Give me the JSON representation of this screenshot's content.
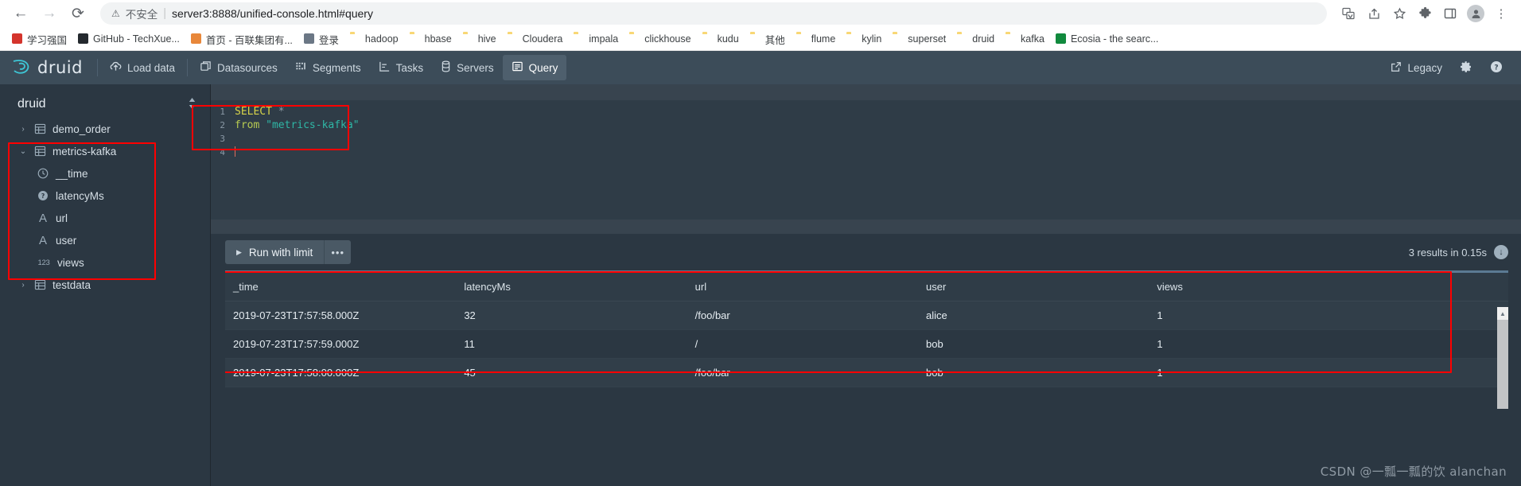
{
  "browser": {
    "back_icon": "back-arrow-icon",
    "forward_icon": "forward-arrow-icon",
    "reload_icon": "reload-icon",
    "security_label": "不安全",
    "url": "server3:8888/unified-console.html#query",
    "toolbar_icons": [
      "translate-icon",
      "share-icon",
      "bookmark-star-icon",
      "extensions-puzzle-icon",
      "sidepanel-icon",
      "profile-avatar-icon",
      "chrome-menu-icon"
    ],
    "bookmarks": [
      {
        "label": "学习强国",
        "icon": "xuexi-icon",
        "color": "#d4342c"
      },
      {
        "label": "GitHub - TechXue...",
        "icon": "github-icon",
        "color": "#24292e"
      },
      {
        "label": "首页 - 百联集团有...",
        "icon": "bailian-icon",
        "color": "#e8873a"
      },
      {
        "label": "登录",
        "icon": "globe-icon",
        "color": "#6b7785"
      },
      {
        "label": "hadoop",
        "icon": "folder-icon",
        "color": "#f8d775"
      },
      {
        "label": "hbase",
        "icon": "folder-icon",
        "color": "#f8d775"
      },
      {
        "label": "hive",
        "icon": "folder-icon",
        "color": "#f8d775"
      },
      {
        "label": "Cloudera",
        "icon": "folder-icon",
        "color": "#f8d775"
      },
      {
        "label": "impala",
        "icon": "folder-icon",
        "color": "#f8d775"
      },
      {
        "label": "clickhouse",
        "icon": "folder-icon",
        "color": "#f8d775"
      },
      {
        "label": "kudu",
        "icon": "folder-icon",
        "color": "#f8d775"
      },
      {
        "label": "其他",
        "icon": "folder-icon",
        "color": "#f8d775"
      },
      {
        "label": "flume",
        "icon": "folder-icon",
        "color": "#f8d775"
      },
      {
        "label": "kylin",
        "icon": "folder-icon",
        "color": "#f8d775"
      },
      {
        "label": "superset",
        "icon": "folder-icon",
        "color": "#f8d775"
      },
      {
        "label": "druid",
        "icon": "folder-icon",
        "color": "#f8d775"
      },
      {
        "label": "kafka",
        "icon": "folder-icon",
        "color": "#f8d775"
      },
      {
        "label": "Ecosia - the searc...",
        "icon": "ecosia-icon",
        "color": "#118a3d"
      }
    ]
  },
  "app": {
    "brand": "druid",
    "nav_items": [
      {
        "label": "Load data",
        "icon": "cloud-upload-icon",
        "active": false
      },
      {
        "label": "Datasources",
        "icon": "datasource-icon",
        "active": false
      },
      {
        "label": "Segments",
        "icon": "segments-icon",
        "active": false
      },
      {
        "label": "Tasks",
        "icon": "tasks-icon",
        "active": false
      },
      {
        "label": "Servers",
        "icon": "servers-icon",
        "active": false
      },
      {
        "label": "Query",
        "icon": "query-icon",
        "active": true
      }
    ],
    "nav_right": {
      "legacy_label": "Legacy",
      "legacy_icon": "external-link-icon",
      "settings_icon": "gear-icon",
      "help_icon": "help-circle-icon"
    }
  },
  "sidebar": {
    "datasource_picker": "druid",
    "picker_icon": "sort-updown-icon",
    "tree": [
      {
        "label": "demo_order",
        "icon": "table-icon",
        "twist": "›",
        "level": 0,
        "expanded": false
      },
      {
        "label": "metrics-kafka",
        "icon": "table-icon",
        "twist": "˅",
        "level": 0,
        "expanded": true
      },
      {
        "label": "__time",
        "icon": "clock-icon",
        "twist": "",
        "level": 1
      },
      {
        "label": "latencyMs",
        "icon": "question-circle-icon",
        "twist": "",
        "level": 1
      },
      {
        "label": "url",
        "icon": "string-type-icon",
        "twist": "",
        "level": 1,
        "glyph": "A"
      },
      {
        "label": "user",
        "icon": "string-type-icon",
        "twist": "",
        "level": 1,
        "glyph": "A"
      },
      {
        "label": "views",
        "icon": "number-type-icon",
        "twist": "",
        "level": 1,
        "glyph": "123"
      },
      {
        "label": "testdata",
        "icon": "table-icon",
        "twist": "›",
        "level": 0,
        "expanded": false
      }
    ]
  },
  "editor": {
    "line_numbers": [
      "1",
      "2",
      "3",
      "4"
    ],
    "sql_line1_keyword": "SELECT",
    "sql_line1_star": "*",
    "sql_line2_keyword": "from",
    "sql_line2_table": "\"metrics-kafka\""
  },
  "toolbar": {
    "run_label": "Run with limit",
    "run_icon": "play-icon",
    "more_label": "•••",
    "results_status": "3 results in 0.15s",
    "download_icon": "download-circle-icon"
  },
  "results": {
    "columns": [
      "_time",
      "latencyMs",
      "url",
      "user",
      "views"
    ],
    "rows": [
      [
        "2019-07-23T17:57:58.000Z",
        "32",
        "/foo/bar",
        "alice",
        "1"
      ],
      [
        "2019-07-23T17:57:59.000Z",
        "11",
        "/",
        "bob",
        "1"
      ],
      [
        "2019-07-23T17:58:00.000Z",
        "45",
        "/foo/bar",
        "bob",
        "1"
      ]
    ],
    "scroll_up_icon": "scroll-up-arrow-icon"
  },
  "annotations": {
    "highlight_color": "#ff0000"
  },
  "watermark": "CSDN @一瓢一瓢的饮 alanchan"
}
